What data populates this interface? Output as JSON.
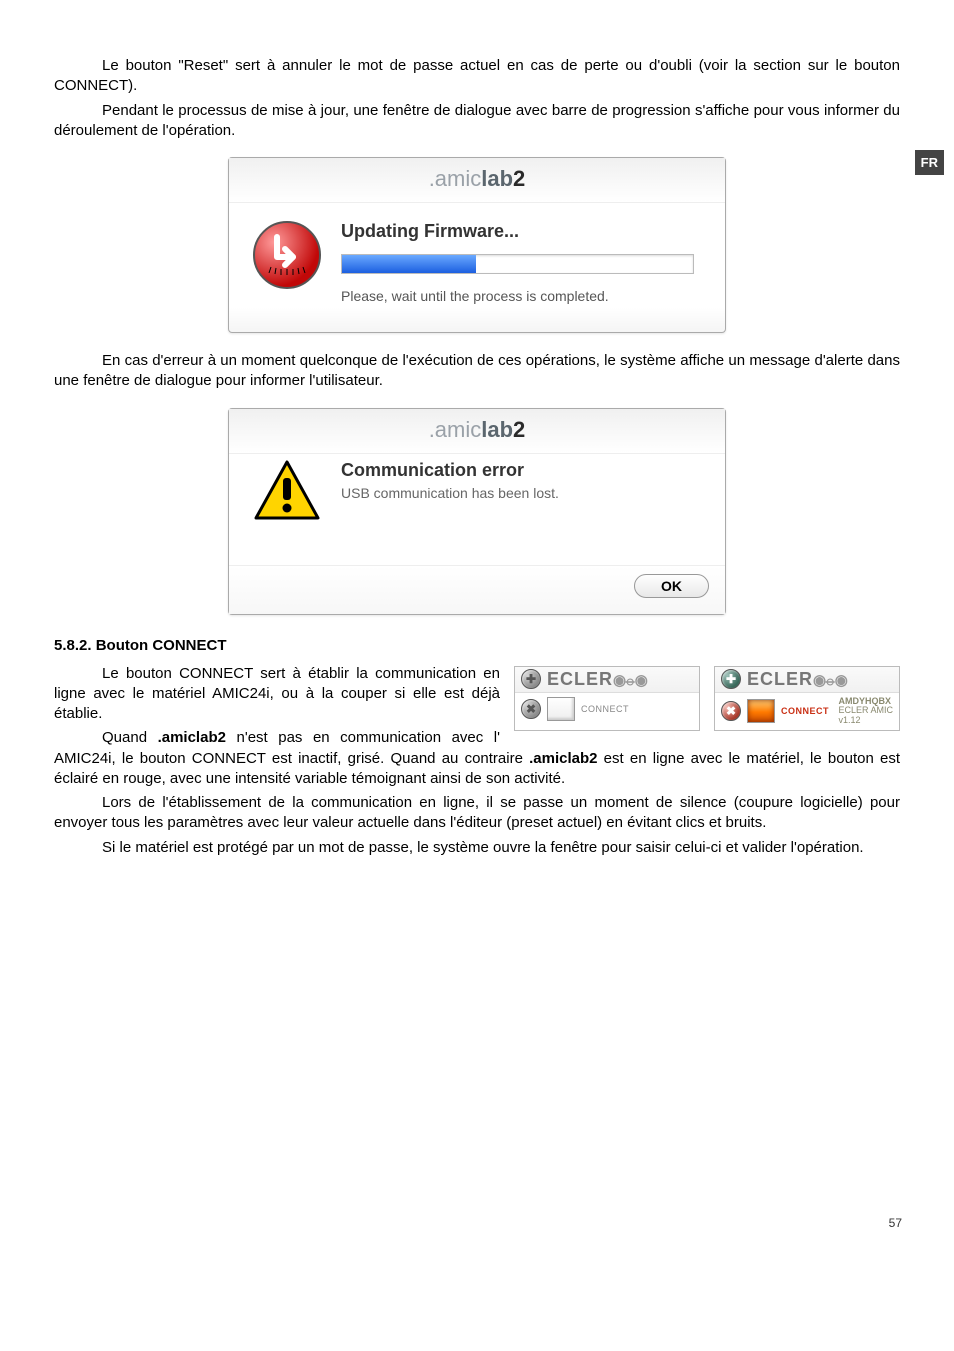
{
  "badge": "FR",
  "para1": "Le bouton \"Reset\" sert à annuler le mot de passe actuel en cas de perte ou d'oubli (voir la section sur le bouton CONNECT).",
  "para2": "Pendant le processus de mise à jour, une fenêtre de dialogue avec barre de progression s'affiche pour vous informer du déroulement de l'opération.",
  "dlg1": {
    "brand_a": ".amic",
    "brand_b": "lab",
    "brand_c": "2",
    "title": "Updating Firmware...",
    "note": "Please, wait until the process is completed."
  },
  "para3": "En cas d'erreur à un moment quelconque de l'exécution de ces opérations, le système affiche un message d'alerte dans une fenêtre de dialogue pour informer l'utilisateur.",
  "dlg2": {
    "brand_a": ".amic",
    "brand_b": "lab",
    "brand_c": "2",
    "title": "Communication error",
    "note": "USB communication has been lost.",
    "ok": "OK"
  },
  "section": "5.8.2. Bouton CONNECT",
  "wrap": {
    "p1a": "Le bouton CONNECT sert à établir la communication en ligne avec le matériel AMIC24i, ou à la couper si elle est déjà établie.",
    "p1b_pre": "Quand ",
    "p1b_bold": ".amiclab2",
    "p1b_post": " n'est pas en communication avec l' AMIC24i, le bouton CONNECT est inactif, grisé. Quand au contraire ",
    "p1b_bold2": ".amiclab2",
    "p1b_tail": " est en ligne avec le matériel, le bouton est éclairé en rouge, avec une intensité variable témoignant ainsi de son activité."
  },
  "para5": "Lors de l'établissement de la communication en ligne, il se passe un moment de silence (coupure logicielle) pour envoyer tous les paramètres avec leur valeur actuelle dans l'éditeur (preset actuel) en évitant clics et bruits.",
  "para6": "Si le matériel est protégé par un mot de passe, le système ouvre la fenêtre pour saisir celui-ci et valider l'opération.",
  "connect": {
    "brand1": "ECLER",
    "label_off": "CONNECT",
    "brand2": "ECLER",
    "label_on": "CONNECT",
    "fw_line1": "AMDYHQBX",
    "fw_line2": "ECLER AMIC",
    "fw_line3": "v1.12"
  },
  "pageno": "57"
}
